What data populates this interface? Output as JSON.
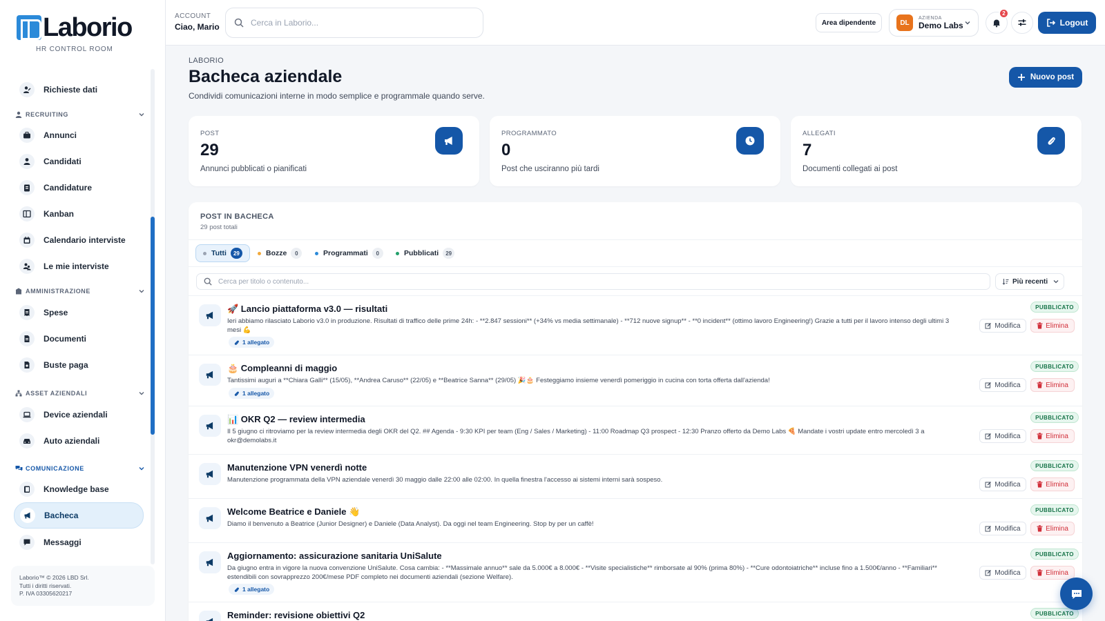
{
  "brand": {
    "name": "Laborio",
    "subtitle": "HR CONTROL ROOM"
  },
  "sidebar": {
    "items": [
      {
        "label": "Richieste dati",
        "icon": "user-edit-icon"
      },
      {
        "section": "RECRUITING"
      },
      {
        "label": "Annunci",
        "icon": "briefcase-icon"
      },
      {
        "label": "Candidati",
        "icon": "user-icon"
      },
      {
        "label": "Candidature",
        "icon": "clipboard-icon"
      },
      {
        "label": "Kanban",
        "icon": "kanban-icon"
      },
      {
        "label": "Calendario interviste",
        "icon": "calendar-icon"
      },
      {
        "label": "Le mie interviste",
        "icon": "users-icon"
      },
      {
        "section": "AMMINISTRAZIONE"
      },
      {
        "label": "Spese",
        "icon": "receipt-icon"
      },
      {
        "label": "Documenti",
        "icon": "document-icon"
      },
      {
        "label": "Buste paga",
        "icon": "payslip-icon"
      },
      {
        "section": "ASSET AZIENDALI"
      },
      {
        "label": "Device aziendali",
        "icon": "laptop-icon"
      },
      {
        "label": "Auto aziendali",
        "icon": "car-icon"
      },
      {
        "section": "COMUNICAZIONE"
      },
      {
        "label": "Knowledge base",
        "icon": "book-icon"
      },
      {
        "label": "Bacheca",
        "icon": "megaphone-icon",
        "active": true
      },
      {
        "label": "Messaggi",
        "icon": "chat-icon"
      }
    ],
    "footer": {
      "line1": "Laborio™ © 2026 LBD Srl.",
      "line2": "Tutti i diritti riservati.",
      "line3": "P. IVA 03305620217"
    }
  },
  "topbar": {
    "account_label": "ACCOUNT",
    "account_name": "Ciao, Mario",
    "search_placeholder": "Cerca in Laborio...",
    "area_button": "Area dipendente",
    "company_initials": "DL",
    "company_label": "AZIENDA",
    "company_name": "Demo Labs",
    "notifications_count": "2",
    "logout_label": "Logout"
  },
  "page": {
    "breadcrumb": "LABORIO",
    "title": "Bacheca aziendale",
    "subtitle": "Condividi comunicazioni interne in modo semplice e programmale quando serve.",
    "new_post_label": "Nuovo post"
  },
  "stats": [
    {
      "label": "POST",
      "value": "29",
      "description": "Annunci pubblicati o pianificati",
      "icon": "megaphone-icon"
    },
    {
      "label": "PROGRAMMATO",
      "value": "0",
      "description": "Post che usciranno più tardi",
      "icon": "clock-icon"
    },
    {
      "label": "ALLEGATI",
      "value": "7",
      "description": "Documenti collegati ai post",
      "icon": "paperclip-icon"
    }
  ],
  "board": {
    "title": "POST IN BACHECA",
    "subtitle": "29 post totali",
    "filters": [
      {
        "label": "Tutti",
        "count": "29",
        "active": true,
        "color": "#9aa3b2"
      },
      {
        "label": "Bozze",
        "count": "0",
        "color": "#f2a93b"
      },
      {
        "label": "Programmati",
        "count": "0",
        "color": "#2b8ad9"
      },
      {
        "label": "Pubblicati",
        "count": "29",
        "color": "#22a06b"
      }
    ],
    "search_placeholder": "Cerca per titolo o contenuto...",
    "sort_label": "Più recenti",
    "status_label": "PUBBLICATO",
    "edit_label": "Modifica",
    "delete_label": "Elimina",
    "posts": [
      {
        "title": "🚀 Lancio piattaforma v3.0 — risultati",
        "body": "Ieri abbiamo rilasciato Laborio v3.0 in produzione. Risultati di traffico delle prime 24h: - **2.847 sessioni** (+34% vs media settimanale) - **712 nuove signup** - **0 incident** (ottimo lavoro Engineering!) Grazie a tutti per il lavoro intenso degli ultimi 3 mesi 💪",
        "attachment": "1 allegato"
      },
      {
        "title": "🎂 Compleanni di maggio",
        "body": "Tantissimi auguri a **Chiara Galli** (15/05), **Andrea Caruso** (22/05) e **Beatrice Sanna** (29/05) 🎉🎂 Festeggiamo insieme venerdì pomeriggio in cucina con torta offerta dall'azienda!",
        "attachment": "1 allegato"
      },
      {
        "title": "📊 OKR Q2 — review intermedia",
        "body": "Il 5 giugno ci ritroviamo per la review intermedia degli OKR del Q2. ## Agenda - 9:30 KPI per team (Eng / Sales / Marketing) - 11:00 Roadmap Q3 prospect - 12:30 Pranzo offerto da Demo Labs 🍕 Mandate i vostri update entro mercoledì 3 a okr@demolabs.it",
        "attachment": ""
      },
      {
        "title": "Manutenzione VPN venerdì notte",
        "body": "Manutenzione programmata della VPN aziendale venerdì 30 maggio dalle 22:00 alle 02:00. In quella finestra l'accesso ai sistemi interni sarà sospeso.",
        "attachment": ""
      },
      {
        "title": "Welcome Beatrice e Daniele 👋",
        "body": "Diamo il benvenuto a Beatrice (Junior Designer) e Daniele (Data Analyst). Da oggi nel team Engineering. Stop by per un caffè!",
        "attachment": ""
      },
      {
        "title": "Aggiornamento: assicurazione sanitaria UniSalute",
        "body": "Da giugno entra in vigore la nuova convenzione UniSalute. Cosa cambia: - **Massimale annuo** sale da 5.000€ a 8.000€ - **Visite specialistiche** rimborsate al 90% (prima 80%) - **Cure odontoiatriche** incluse fino a 1.500€/anno - **Familiari** estendibili con sovrapprezzo 200€/mese PDF completo nei documenti aziendali (sezione Welfare).",
        "attachment": "1 allegato"
      },
      {
        "title": "Reminder: revisione obiettivi Q2",
        "body": "",
        "attachment": ""
      }
    ]
  }
}
